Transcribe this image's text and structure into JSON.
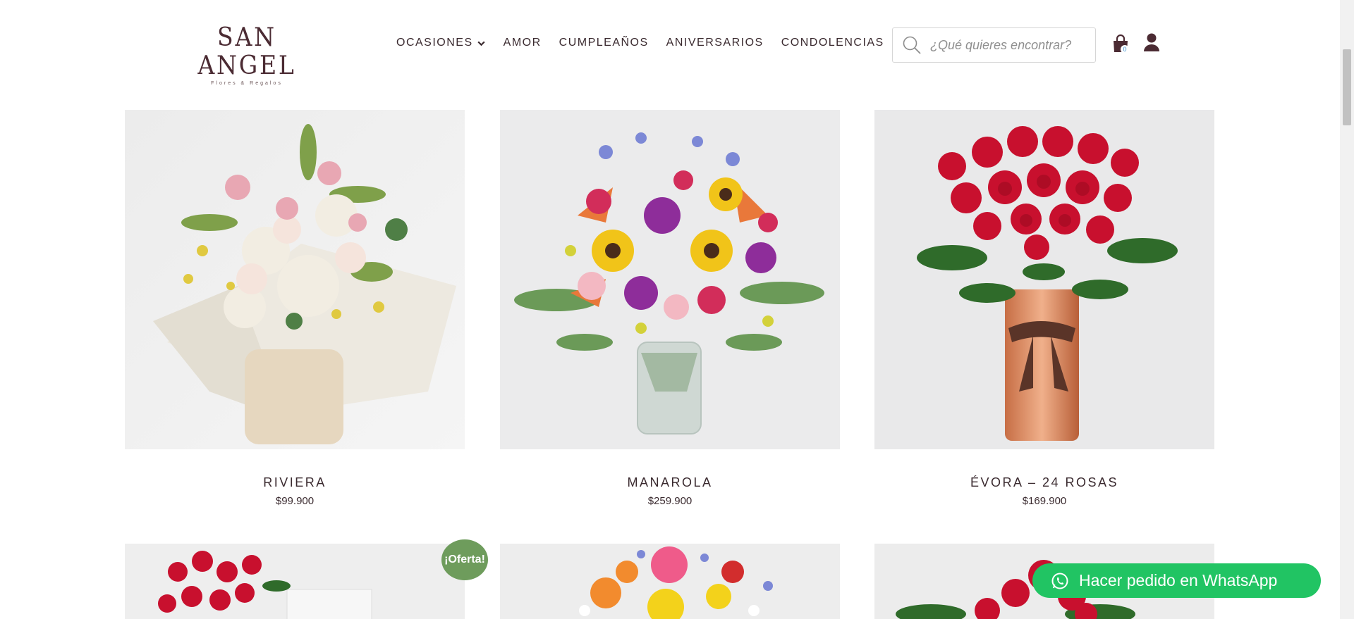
{
  "header": {
    "logo_main": "SAN ANGEL",
    "logo_sub": "Flores & Regalos",
    "nav": [
      {
        "label": "OCASIONES"
      },
      {
        "label": "AMOR"
      },
      {
        "label": "CUMPLEAÑOS"
      },
      {
        "label": "ANIVERSARIOS"
      },
      {
        "label": "CONDOLENCIAS"
      }
    ],
    "search_placeholder": "¿Qué quieres encontrar?",
    "cart_count": "0"
  },
  "products": [
    {
      "name": "RIVIERA",
      "price": "$99.900"
    },
    {
      "name": "MANAROLA",
      "price": "$259.900"
    },
    {
      "name": "ÉVORA – 24 ROSAS",
      "price": "$169.900"
    }
  ],
  "badge": {
    "label": "¡Oferta!"
  },
  "whatsapp": {
    "label": "Hacer pedido en WhatsApp"
  },
  "colors": {
    "brand": "#4b2b33",
    "whatsapp": "#21c463",
    "badge": "#6e9c5c"
  }
}
